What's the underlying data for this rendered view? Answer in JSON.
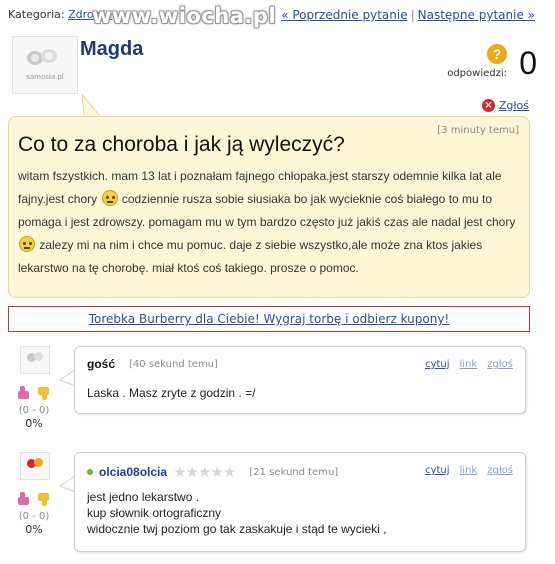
{
  "topbar": {
    "category_label": "Kategoria:",
    "category_link": "Zdrowie",
    "watermark": "www.wiocha.pl",
    "prev_label": "« Poprzednie pytanie",
    "separator": "|",
    "next_label": "Następne pytanie »"
  },
  "author": {
    "name": "Magda",
    "avatar_text": "samosia.pl"
  },
  "answers": {
    "label": "odpowiedzi:",
    "count": "0",
    "icon_glyph": "?"
  },
  "report": {
    "icon_glyph": "×",
    "label": "Zgłoś"
  },
  "question": {
    "time": "[3 minuty temu]",
    "title": "Co to za choroba i jak ją wyleczyć?",
    "body_1": "witam fszystkich. mam 13 lat i poznałam fajnego chłopaka.jest starszy odemnie kilka lat ale fajny.jest chory",
    "body_2": "codziennie rusza sobie siusiaka bo jak wycieknie coś białego to mu to pomaga i jest zdrowszy. pomagam mu w tym bardzo często już jakiś czas ale nadal jest chory",
    "body_3": "zalezy mi na nim i chce mu pomuc. daje z siebie wszystko,ale może zna ktos jakies lekarstwo na tę chorobę. miał ktoś coś takiego. prosze o pomoc."
  },
  "ad": {
    "label": "Torebka Burberry dla Ciebie! Wygraj torbę i odbierz kupony!"
  },
  "answer_list": [
    {
      "user": "gość",
      "time": "[40 sekund temu]",
      "links": [
        "cytuj",
        "link",
        "zgłoś"
      ],
      "lines": [
        "Laska . Masz zryte z godzin . =/"
      ],
      "vote_count": "(0 - 0)",
      "vote_pct": "0%"
    },
    {
      "user": "olcia08olcia",
      "stars": "★★★★★",
      "time": "[21 sekund temu]",
      "links": [
        "cytuj",
        "link",
        "zgłoś"
      ],
      "lines": [
        "jest jedno lekarstwo .",
        "kup słownik ortograficzny",
        "widocznie twj poziom go tak zaskakuje i stąd te wycieki ,"
      ],
      "vote_count": "(0 - 0)",
      "vote_pct": "0%"
    }
  ],
  "icons": {
    "emoji": "smiley-icon",
    "thumb_up": "thumb-up-icon",
    "thumb_down": "thumb-down-icon",
    "online": "online-dot-icon"
  },
  "colors": {
    "question_bg": "#fbf7d6",
    "link": "#2a4ea0",
    "ad_border": "#c0392b",
    "report_icon": "#d7262e",
    "answers_icon": "#f2a71b"
  }
}
